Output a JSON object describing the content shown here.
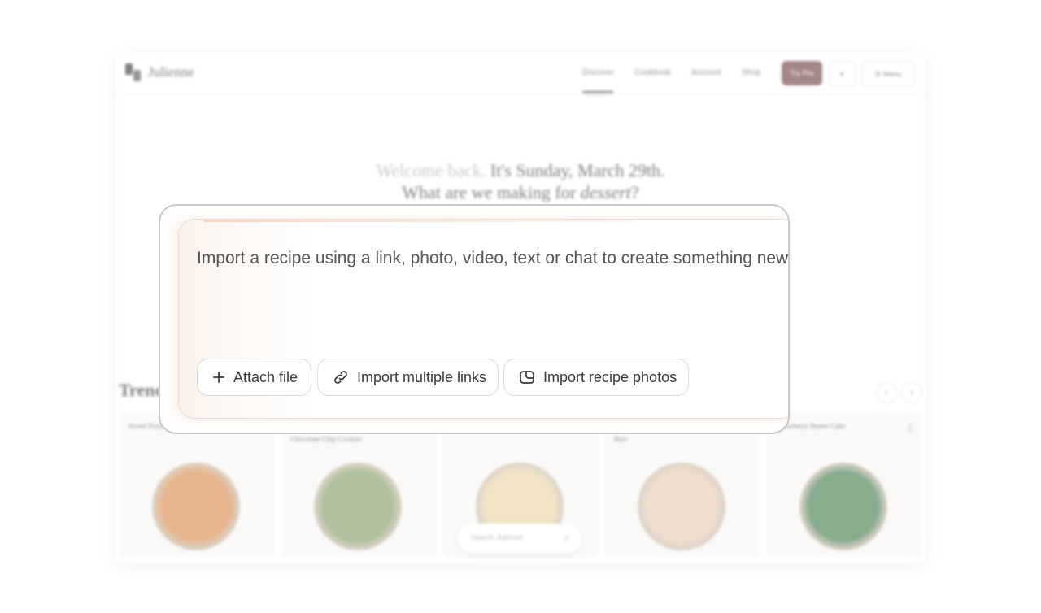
{
  "app": {
    "brand": "Julienne",
    "nav": [
      "Discover",
      "Cookbook",
      "Account",
      "Shop"
    ],
    "active_nav": "Discover",
    "try_pro_label": "Try Pro",
    "theme_toggle_glyph": "◐",
    "menu_label": "Menu"
  },
  "hero": {
    "welcome_muted": "Welcome back.",
    "welcome_date": "It's Sunday, March 29th.",
    "question_prefix": "What are we making for",
    "question_meal": "dessert",
    "question_suffix": "?"
  },
  "trending": {
    "heading": "Trending",
    "prev_glyph": "‹",
    "next_glyph": "›",
    "cards": [
      {
        "title": "Sweet Potato",
        "plate_color": "#d98a4a"
      },
      {
        "title": "Chocolate Chip Cookies",
        "plate_color": "#7d9a63"
      },
      {
        "title": "",
        "plate_color": "#e9d6a4"
      },
      {
        "title": "Bars",
        "plate_color": "#e6cbb2"
      },
      {
        "title": "Strawberry Butter Cake",
        "plate_color": "#3f7a4a"
      }
    ]
  },
  "search": {
    "placeholder": "Search Julienne"
  },
  "import_panel": {
    "prompt": "Import a recipe using a link, photo, video, text or chat to create something new!",
    "attach_label": "Attach file",
    "links_label": "Import multiple links",
    "photos_label": "Import recipe photos",
    "icons": [
      "plus-icon",
      "link-icon",
      "photos-icon"
    ]
  }
}
